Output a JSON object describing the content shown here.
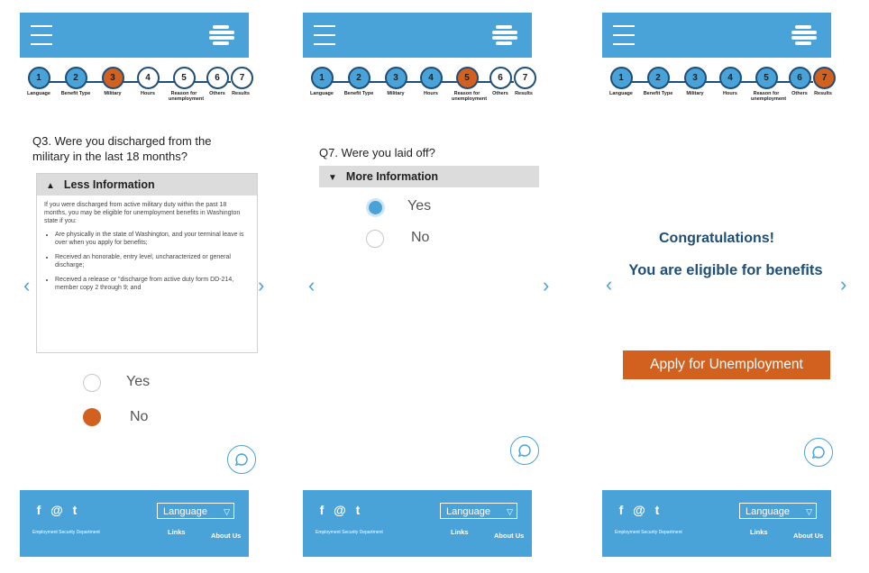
{
  "steps": [
    {
      "num": "1",
      "label": "Language"
    },
    {
      "num": "2",
      "label": "Benefit Type"
    },
    {
      "num": "3",
      "label": "Military"
    },
    {
      "num": "4",
      "label": "Hours"
    },
    {
      "num": "5",
      "label": "Reason for unemployment"
    },
    {
      "num": "6",
      "label": "Others"
    },
    {
      "num": "7",
      "label": "Results"
    }
  ],
  "nav": {
    "prev": "‹",
    "next": "›"
  },
  "screen1": {
    "question": "Q3. Were you discharged from the military in the last 18 months?",
    "info_toggle": "Less Information",
    "info_intro": "If you were discharged from active military duty within the past 18 months, you may be eligible for unemployment benefits in Washington state if you:",
    "info_bullets": [
      "Are physically in the state of Washington, and your terminal leave is over when you apply for benefits;",
      "Received an honorable, entry level, uncharacterized or general discharge;",
      "Received a release or \"discharge from active duty form DD-214, member copy 2 through 9; and"
    ],
    "opt_yes": "Yes",
    "opt_no": "No",
    "selected": "No"
  },
  "screen2": {
    "question": "Q7. Were you laid off?",
    "info_toggle": "More Information",
    "opt_yes": "Yes",
    "opt_no": "No",
    "selected": "Yes"
  },
  "screen3": {
    "line1": "Congratulations!",
    "line2": "You are eligible for benefits",
    "apply_button": "Apply for Unemployment"
  },
  "footer": {
    "language_select": "Language",
    "links": "Links",
    "about": "About Us",
    "dept": "Employment Security Department"
  },
  "colors": {
    "primary": "#4aa3d8",
    "accent": "#d2601f",
    "navy": "#1f4e79"
  }
}
